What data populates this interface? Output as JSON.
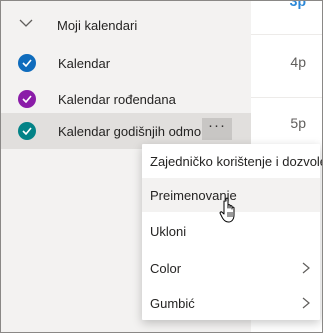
{
  "section": {
    "title": "Moji kalendari",
    "icon": "chevron-down-icon"
  },
  "calendars": [
    {
      "label": "Kalendar",
      "color": "#0f6cbd",
      "checked": true
    },
    {
      "label": "Kalendar rođendana",
      "color": "#8a1ca8",
      "checked": true
    },
    {
      "label": "Kalendar godišnjih odmora",
      "color": "#038387",
      "checked": true
    }
  ],
  "more_button": {
    "label": "···",
    "icon": "more-icon"
  },
  "time_labels": [
    "3p",
    "4p",
    "5p"
  ],
  "context_menu": {
    "items": [
      {
        "label": "Zajedničko korištenje i dozvole",
        "submenu": false
      },
      {
        "label": "Preimenovanje",
        "submenu": false,
        "hovered": true
      },
      {
        "label": "Ukloni",
        "submenu": false
      },
      {
        "label": "Color",
        "submenu": true
      },
      {
        "label": "Gumbić",
        "submenu": true
      }
    ]
  },
  "colors": {
    "sidebar_bg": "#f3f2f1",
    "hover_row": "#e1dfdd",
    "accent": "#2b88d8"
  }
}
